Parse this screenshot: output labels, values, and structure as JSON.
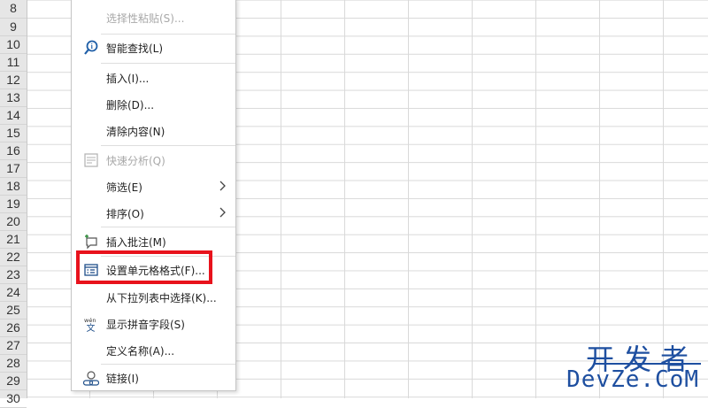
{
  "rows": [
    "8",
    "9",
    "10",
    "11",
    "12",
    "13",
    "14",
    "15",
    "16",
    "17",
    "18",
    "19",
    "20",
    "21",
    "22",
    "23",
    "24",
    "25",
    "26",
    "27",
    "28",
    "29",
    "30"
  ],
  "menu": {
    "items": [
      {
        "label": "选择性粘贴(S)...",
        "disabled": true,
        "icon": null
      },
      {
        "label": "智能查找(L)",
        "disabled": false,
        "icon": "smart-lookup-icon"
      },
      {
        "label": "插入(I)...",
        "disabled": false,
        "icon": null
      },
      {
        "label": "删除(D)...",
        "disabled": false,
        "icon": null
      },
      {
        "label": "清除内容(N)",
        "disabled": false,
        "icon": null
      },
      {
        "label": "快速分析(Q)",
        "disabled": true,
        "icon": "quick-analysis-icon"
      },
      {
        "label": "筛选(E)",
        "disabled": false,
        "icon": null,
        "submenu": true
      },
      {
        "label": "排序(O)",
        "disabled": false,
        "icon": null,
        "submenu": true
      },
      {
        "label": "插入批注(M)",
        "disabled": false,
        "icon": "comment-icon"
      },
      {
        "label": "设置单元格格式(F)...",
        "disabled": false,
        "icon": "format-cells-icon"
      },
      {
        "label": "从下拉列表中选择(K)...",
        "disabled": false,
        "icon": null
      },
      {
        "label": "显示拼音字段(S)",
        "disabled": false,
        "icon": "phonetic-icon"
      },
      {
        "label": "定义名称(A)...",
        "disabled": false,
        "icon": null
      },
      {
        "label": "链接(I)",
        "disabled": false,
        "icon": "link-icon"
      }
    ]
  },
  "watermark": {
    "cn": "开发者",
    "en": "DevZe.CoM"
  },
  "colors": {
    "highlight": "#e8121c",
    "watermark": "#1e4fa0"
  }
}
